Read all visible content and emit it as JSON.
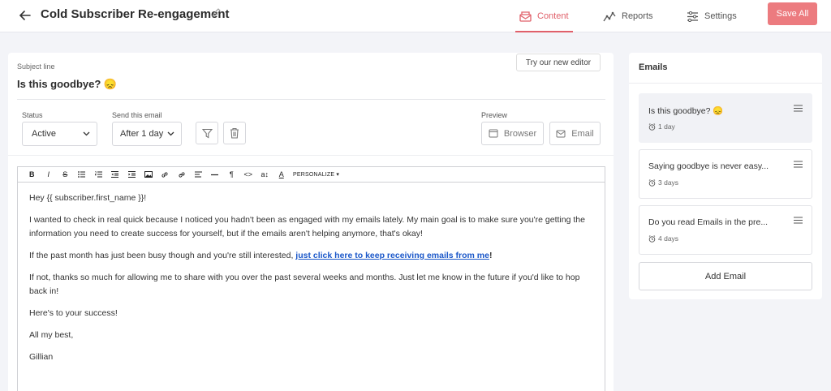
{
  "header": {
    "title": "Cold Subscriber Re-engagement",
    "nav": [
      {
        "label": "Content",
        "icon": "envelope-icon",
        "active": true
      },
      {
        "label": "Reports",
        "icon": "chart-icon"
      },
      {
        "label": "Settings",
        "icon": "sliders-icon"
      }
    ],
    "save_label": "Save All",
    "accent": "#e0606a"
  },
  "editor_panel": {
    "try_editor": "Try our new editor",
    "subject_label": "Subject line",
    "subject_value": "Is this goodbye? 😞",
    "status_label": "Status",
    "status_value": "Active",
    "send_label": "Send this email",
    "send_value": "After 1 day",
    "preview_label": "Preview",
    "browser_label": "Browser",
    "email_label": "Email",
    "toolbar": {
      "bold": "B",
      "italic": "I",
      "strike": "S",
      "paragraph": "¶",
      "code": "<>",
      "size": "a↕",
      "font": "A",
      "personalize": "PERSONALIZE ▾"
    },
    "body": {
      "greeting": "Hey {{ subscriber.first_name }}!",
      "p1": "I wanted to check in real quick because I noticed you hadn't been as engaged with my emails lately. My main goal is to make sure you're getting the information you need to create success for yourself, but if the emails aren't helping anymore, that's okay!",
      "p2_before": "If the past month has just been busy though and you're still interested, ",
      "p2_link": "just click here to keep receiving emails from me",
      "p2_after": "!",
      "p3": "If not, thanks so much for allowing me to share with you over the past several weeks and months. Just let me know in the future if you'd like to hop back in!",
      "p4": "Here's to your success!",
      "p5": "All my best,",
      "p6": "Gillian"
    }
  },
  "sidebar": {
    "title": "Emails",
    "emails": [
      {
        "subject": "Is this goodbye? 😞",
        "delay": "1 day",
        "active": true
      },
      {
        "subject": "Saying goodbye is never easy...",
        "delay": "3 days"
      },
      {
        "subject": "Do you read Emails in the pre...",
        "delay": "4 days"
      }
    ],
    "add_label": "Add Email"
  }
}
